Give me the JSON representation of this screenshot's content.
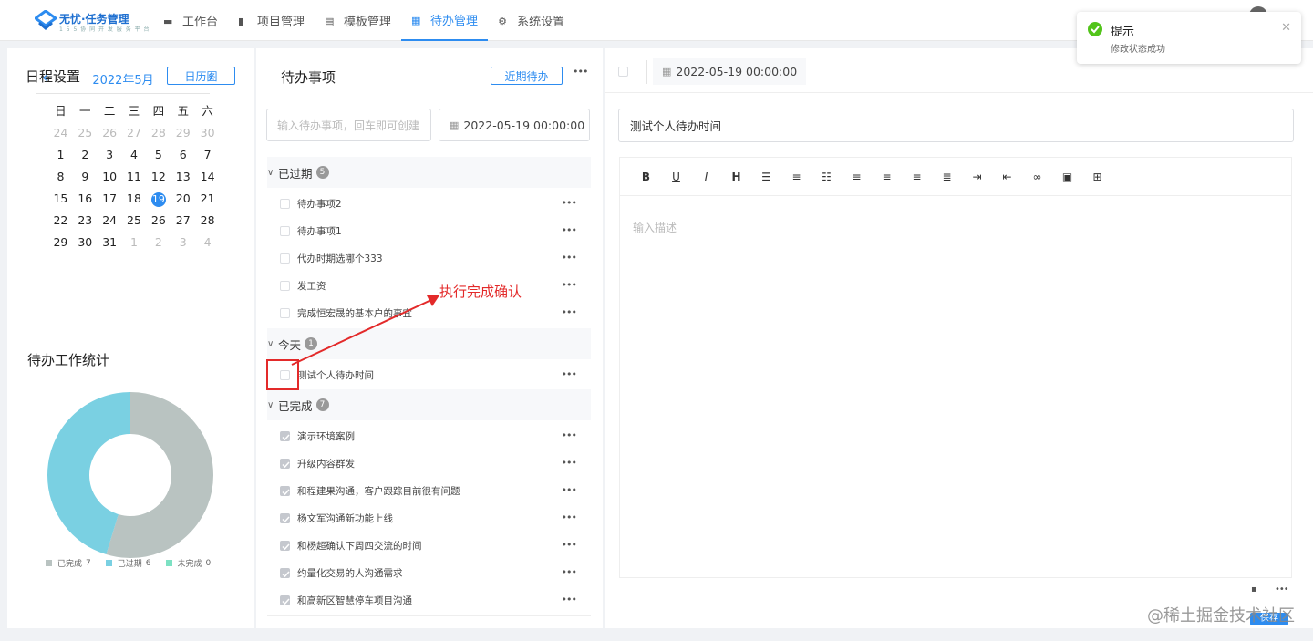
{
  "header": {
    "logo_title": "无忧·任务管理",
    "logo_subtitle": "1 5 5 协 同 开 发 服 务 平 台",
    "nav": [
      {
        "label": "工作台",
        "icon": "monitor-icon"
      },
      {
        "label": "项目管理",
        "icon": "clipboard-icon"
      },
      {
        "label": "模板管理",
        "icon": "template-icon"
      },
      {
        "label": "待办管理",
        "icon": "calendar-icon"
      },
      {
        "label": "系统设置",
        "icon": "gear-icon"
      }
    ],
    "active_nav": "待办管理"
  },
  "schedule": {
    "title": "日程设置",
    "calendar_button": "日历图",
    "month_label": "2022年5月",
    "weekdays": [
      "日",
      "一",
      "二",
      "三",
      "四",
      "五",
      "六"
    ],
    "weeks": [
      [
        {
          "d": "24",
          "dim": true
        },
        {
          "d": "25",
          "dim": true
        },
        {
          "d": "26",
          "dim": true
        },
        {
          "d": "27",
          "dim": true
        },
        {
          "d": "28",
          "dim": true
        },
        {
          "d": "29",
          "dim": true
        },
        {
          "d": "30",
          "dim": true
        }
      ],
      [
        {
          "d": "1"
        },
        {
          "d": "2"
        },
        {
          "d": "3"
        },
        {
          "d": "4"
        },
        {
          "d": "5"
        },
        {
          "d": "6"
        },
        {
          "d": "7"
        }
      ],
      [
        {
          "d": "8"
        },
        {
          "d": "9"
        },
        {
          "d": "10"
        },
        {
          "d": "11"
        },
        {
          "d": "12"
        },
        {
          "d": "13"
        },
        {
          "d": "14"
        }
      ],
      [
        {
          "d": "15"
        },
        {
          "d": "16"
        },
        {
          "d": "17"
        },
        {
          "d": "18"
        },
        {
          "d": "19",
          "today": true
        },
        {
          "d": "20"
        },
        {
          "d": "21"
        }
      ],
      [
        {
          "d": "22"
        },
        {
          "d": "23"
        },
        {
          "d": "24"
        },
        {
          "d": "25"
        },
        {
          "d": "26"
        },
        {
          "d": "27"
        },
        {
          "d": "28"
        }
      ],
      [
        {
          "d": "29"
        },
        {
          "d": "30"
        },
        {
          "d": "31"
        },
        {
          "d": "1",
          "dim": true
        },
        {
          "d": "2",
          "dim": true
        },
        {
          "d": "3",
          "dim": true
        },
        {
          "d": "4",
          "dim": true
        }
      ]
    ]
  },
  "stats": {
    "title": "待办工作统计",
    "legend": [
      {
        "label": "已完成",
        "value": "7",
        "color": "#b9c3c1"
      },
      {
        "label": "已过期",
        "value": "6",
        "color": "#7ad0e2"
      },
      {
        "label": "未完成",
        "value": "0",
        "color": "#7de1c3"
      }
    ]
  },
  "todo": {
    "title": "待办事项",
    "recent_button": "近期待办",
    "input_placeholder": "输入待办事项，回车即可创建",
    "date_value": "2022-05-19 00:00:00",
    "groups": [
      {
        "name": "已过期",
        "count": "5",
        "items": [
          {
            "text": "待办事项2",
            "done": false
          },
          {
            "text": "待办事项1",
            "done": false
          },
          {
            "text": "代办时期选哪个333",
            "done": false
          },
          {
            "text": "发工资",
            "done": false
          },
          {
            "text": "完成恒宏晟的基本户的事宜",
            "done": false
          }
        ]
      },
      {
        "name": "今天",
        "count": "1",
        "items": [
          {
            "text": "测试个人待办时间",
            "done": false
          }
        ]
      },
      {
        "name": "已完成",
        "count": "7",
        "items": [
          {
            "text": "演示环境案例",
            "done": true
          },
          {
            "text": "升级内容群发",
            "done": true
          },
          {
            "text": "和程建果沟通，客户跟踪目前很有问题",
            "done": true
          },
          {
            "text": "杨文军沟通新功能上线",
            "done": true
          },
          {
            "text": "和杨超确认下周四交流的时间",
            "done": true
          },
          {
            "text": "约量化交易的人沟通需求",
            "done": true
          },
          {
            "text": "和高新区智慧停车项目沟通",
            "done": true
          }
        ]
      }
    ]
  },
  "detail": {
    "date_value": "2022-05-19 00:00:00",
    "title_value": "测试个人待办时间",
    "description_placeholder": "输入描述",
    "toolbar": [
      "B",
      "U",
      "I",
      "H",
      "bullet-list",
      "ordered-list",
      "task-list",
      "align-left",
      "align-center",
      "align-right",
      "justify",
      "indent",
      "outdent",
      "link",
      "image",
      "table"
    ]
  },
  "toast": {
    "title": "提示",
    "message": "修改状态成功"
  },
  "annotation": "执行完成确认",
  "watermark": "@稀土掘金技术社区",
  "save_button": "保存"
}
